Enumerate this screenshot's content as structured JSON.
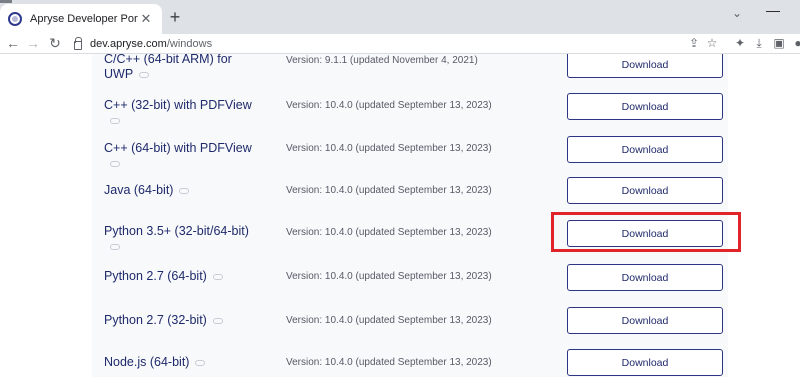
{
  "browser": {
    "tab_title": "Apryse Developer Portal",
    "tab_close": "✕",
    "new_tab": "+",
    "chevron": "⌄",
    "minimize": "—",
    "back": "←",
    "forward": "→",
    "reload": "↻",
    "url_host": "dev.apryse.com",
    "url_path": "/windows",
    "icons": {
      "share": "⇪",
      "bookmark": "☆",
      "extensions": "✦",
      "download": "⤓",
      "sidepanel": "▣",
      "profile": "●"
    }
  },
  "downloads": {
    "button_label": "Download",
    "rows": [
      {
        "name": "C/C++ (64-bit ARM) for UWP",
        "version": "Version: 9.1.1 (updated November 4, 2021)"
      },
      {
        "name": "C++ (32-bit) with PDFView",
        "version": "Version: 10.4.0 (updated September 13, 2023)"
      },
      {
        "name": "C++ (64-bit) with PDFView",
        "version": "Version: 10.4.0 (updated September 13, 2023)"
      },
      {
        "name": "Java (64-bit)",
        "version": "Version: 10.4.0 (updated September 13, 2023)"
      },
      {
        "name": "Python 3.5+ (32-bit/64-bit)",
        "version": "Version: 10.4.0 (updated September 13, 2023)"
      },
      {
        "name": "Python 2.7 (64-bit)",
        "version": "Version: 10.4.0 (updated September 13, 2023)"
      },
      {
        "name": "Python 2.7 (32-bit)",
        "version": "Version: 10.4.0 (updated September 13, 2023)"
      },
      {
        "name": "Node.js (64-bit)",
        "version": "Version: 10.4.0 (updated September 13, 2023)"
      }
    ],
    "highlighted_row": 4
  }
}
